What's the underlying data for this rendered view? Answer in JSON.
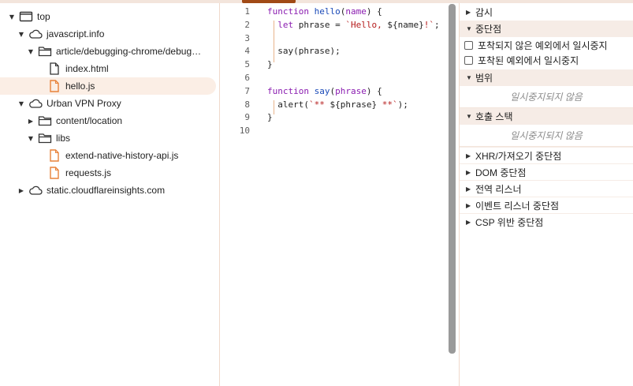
{
  "navigator": {
    "items": [
      {
        "label": "top"
      },
      {
        "label": "javascript.info"
      },
      {
        "label": "article/debugging-chrome/debug…"
      },
      {
        "label": "index.html"
      },
      {
        "label": "hello.js"
      },
      {
        "label": "Urban VPN Proxy"
      },
      {
        "label": "content/location"
      },
      {
        "label": "libs"
      },
      {
        "label": "extend-native-history-api.js"
      },
      {
        "label": "requests.js"
      },
      {
        "label": "static.cloudflareinsights.com"
      }
    ]
  },
  "editor": {
    "line_numbers": [
      "1",
      "2",
      "3",
      "4",
      "5",
      "6",
      "7",
      "8",
      "9",
      "10"
    ],
    "lines": [
      [
        {
          "t": "function",
          "c": "kw"
        },
        {
          "t": " "
        },
        {
          "t": "hello",
          "c": "fn"
        },
        {
          "t": "("
        },
        {
          "t": "name",
          "c": "kw"
        },
        {
          "t": ") {"
        }
      ],
      [
        {
          "t": "  "
        },
        {
          "t": "let",
          "c": "kw"
        },
        {
          "t": " phrase = "
        },
        {
          "t": "`Hello, ",
          "c": "str"
        },
        {
          "t": "${name}"
        },
        {
          "t": "!`",
          "c": "str"
        },
        {
          "t": ";"
        }
      ],
      [
        {
          "t": ""
        }
      ],
      [
        {
          "t": "  say(phrase);"
        }
      ],
      [
        {
          "t": "}"
        }
      ],
      [
        {
          "t": ""
        }
      ],
      [
        {
          "t": "function",
          "c": "kw"
        },
        {
          "t": " "
        },
        {
          "t": "say",
          "c": "fn"
        },
        {
          "t": "("
        },
        {
          "t": "phrase",
          "c": "kw"
        },
        {
          "t": ") {"
        }
      ],
      [
        {
          "t": "  alert("
        },
        {
          "t": "`** ",
          "c": "str"
        },
        {
          "t": "${phrase}"
        },
        {
          "t": " **`",
          "c": "str"
        },
        {
          "t": ");"
        }
      ],
      [
        {
          "t": "}"
        }
      ],
      [
        {
          "t": ""
        }
      ]
    ]
  },
  "sidebar": {
    "watch": "감시",
    "breakpoints": "중단점",
    "pause_uncaught": "포착되지 않은 예외에서 일시중지",
    "pause_caught": "포착된 예외에서 일시중지",
    "scope": "범위",
    "scope_empty": "일시중지되지 않음",
    "callstack": "호출 스택",
    "callstack_empty": "일시중지되지 않음",
    "xhr": "XHR/가져오기 중단점",
    "dom": "DOM 중단점",
    "global": "전역 리스너",
    "event": "이벤트 리스너 중단점",
    "csp": "CSP 위반 중단점"
  },
  "colors": {
    "accent": "#a14a16",
    "selected_row": "#fbeee5",
    "file_icon_js": "#e8823a",
    "folder_icon": "#c0632a"
  }
}
